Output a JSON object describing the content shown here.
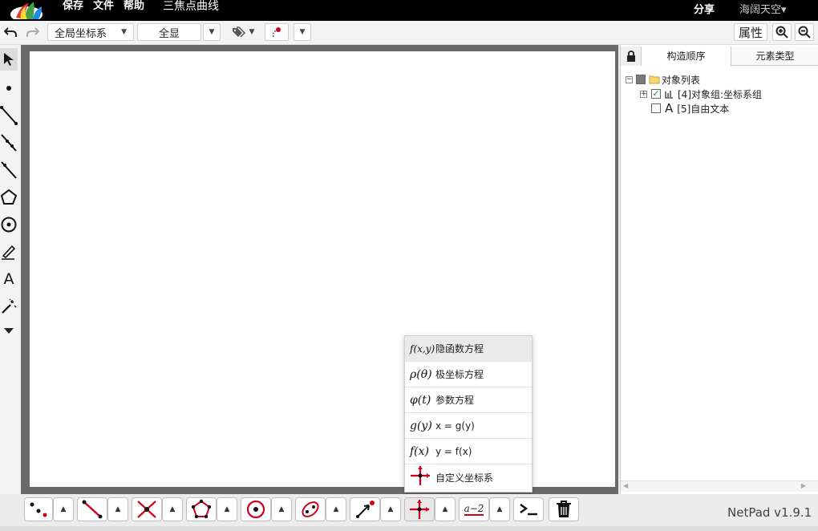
{
  "topbar": {
    "menu": [
      "保存",
      "文件",
      "帮助"
    ],
    "doc_title": "三焦点曲线",
    "share": "分享",
    "user": "海阔天空▾"
  },
  "toolbar": {
    "coord_select": "全局坐标系",
    "show_select": "全显",
    "properties": "属性"
  },
  "left_tools": [
    "select-arrow-icon",
    "point-icon",
    "segment-icon",
    "ray-icon",
    "line-icon",
    "polygon-icon",
    "circle-icon",
    "pen-icon",
    "text-tool-icon",
    "magic-icon",
    "more-caret-icon"
  ],
  "left_text_tool": "A",
  "right_panel": {
    "tabs": [
      "构造顺序",
      "元素类型"
    ],
    "tree": {
      "root": "对象列表",
      "item1": "[4]对象组:坐标系组",
      "item2_glyph": "A",
      "item2": "[5]自由文本"
    }
  },
  "popup_menu": [
    {
      "icon": "f(x,y)",
      "label": "隐函数方程"
    },
    {
      "icon": "ρ(θ)",
      "label": "极坐标方程"
    },
    {
      "icon": "φ(t)",
      "label": "参数方程"
    },
    {
      "icon": "g(y)",
      "label": "x = g(y)"
    },
    {
      "icon": "f(x)",
      "label": "y = f(x)"
    },
    {
      "icon": "axes-icon",
      "label": "自定义坐标系"
    }
  ],
  "bottom_tools": [
    "points-icon",
    "segment-tool-icon",
    "intersect-icon",
    "polygon-tool-icon",
    "circle-tool-icon",
    "conic-icon",
    "vector-icon",
    "coordinate-icon",
    "expression-icon",
    "console-icon",
    "trash-icon"
  ],
  "bottom_expression_glyph": "a−2",
  "version": "NetPad v1.9.1",
  "colors": {
    "accent_red": "#d0021b",
    "canvas_border": "#6a6a6a",
    "check_green": "#2e8b2e"
  }
}
